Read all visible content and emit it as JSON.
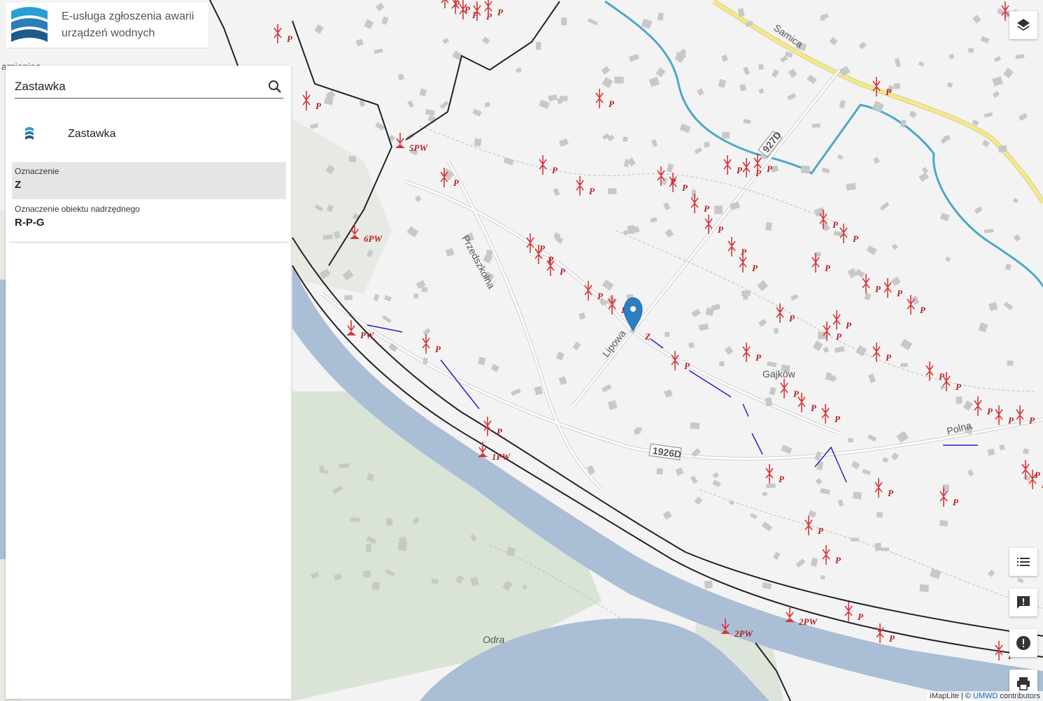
{
  "header": {
    "title_line1": "E-usługa zgłoszenia awarii",
    "title_line2": "urządzeń wodnych"
  },
  "search": {
    "value": "Zastawka"
  },
  "result": {
    "label": "Zastawka"
  },
  "attributes": [
    {
      "label": "Oznaczenie",
      "value": "Z"
    },
    {
      "label": "Oznaczenie obiektu nadrzędnego",
      "value": "R-P-G"
    }
  ],
  "map": {
    "place_labels": [
      "Gajków",
      "Odra",
      "Samica",
      "Przedszkolna",
      "Lipowa",
      "Polna",
      "1926D",
      "927D",
      "amieniec"
    ],
    "symbol_labels": {
      "pw": [
        "5PW",
        "6PW",
        "PW",
        "1PW",
        "2PW",
        "2PW",
        "1PW"
      ],
      "selected": "Z",
      "p": "P"
    },
    "colors": {
      "water": "#aabed6",
      "river_line": "#4aa8c9",
      "symbols": "#d9343b",
      "rail": "#222222",
      "main_road": "#f2e98c",
      "blue_lines": "#2222cc",
      "marker": "#2d7fc1"
    }
  },
  "controls": [
    "layers-button",
    "legend-button",
    "report-button",
    "alert-button",
    "print-button"
  ],
  "attribution": {
    "prefix": "iMapLite | ©",
    "link": "UMWD",
    "suffix": "contributors"
  }
}
